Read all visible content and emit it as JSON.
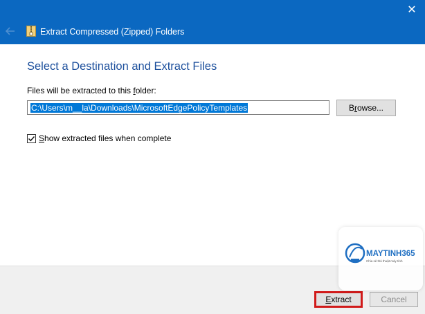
{
  "window": {
    "title": "Extract Compressed (Zipped) Folders",
    "close_glyph": "✕"
  },
  "main": {
    "heading": "Select a Destination and Extract Files",
    "dest_label_pre": "Files will be extracted to this ",
    "dest_label_accel": "f",
    "dest_label_post": "older:",
    "path_value": "C:\\Users\\m__la\\Downloads\\MicrosoftEdgePolicyTemplates",
    "browse_pre": "B",
    "browse_accel": "r",
    "browse_post": "owse...",
    "show_files_accel": "S",
    "show_files_post": "how extracted files when complete",
    "show_files_checked": true
  },
  "footer": {
    "extract_accel": "E",
    "extract_post": "xtract",
    "cancel_label": "Cancel"
  },
  "watermark": {
    "brand": "MAYTINH365",
    "tagline": "Chia sẻ thủ thuật máy tính"
  },
  "colors": {
    "titlebar": "#0b68c1",
    "heading": "#1c4f9c",
    "selection": "#0078d7",
    "highlight_border": "#d11a1a"
  },
  "icons": {
    "back": "back-arrow-icon",
    "zip": "zip-folder-icon",
    "close": "close-icon",
    "check": "checkmark-icon"
  }
}
